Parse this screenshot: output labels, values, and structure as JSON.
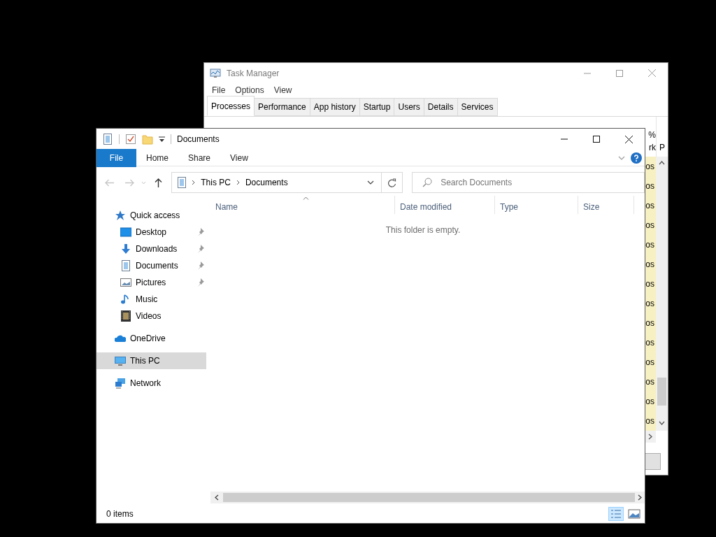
{
  "task_manager": {
    "title": "Task Manager",
    "menu": [
      "File",
      "Options",
      "View"
    ],
    "tabs": [
      {
        "label": "Processes",
        "selected": true
      },
      {
        "label": "Performance",
        "selected": false
      },
      {
        "label": "App history",
        "selected": false
      },
      {
        "label": "Startup",
        "selected": false
      },
      {
        "label": "Users",
        "selected": false
      },
      {
        "label": "Details",
        "selected": false
      },
      {
        "label": "Services",
        "selected": false
      }
    ],
    "column_headers": [
      "%",
      "rk",
      "P"
    ],
    "cells": [
      "os",
      "os",
      "os",
      "os",
      "os",
      "os",
      "os",
      "os",
      "os",
      "os",
      "os",
      "os",
      "os",
      "os"
    ]
  },
  "explorer": {
    "title": "Documents",
    "ribbon_tabs": [
      {
        "label": "File",
        "kind": "file"
      },
      {
        "label": "Home",
        "kind": "tab"
      },
      {
        "label": "Share",
        "kind": "tab"
      },
      {
        "label": "View",
        "kind": "tab"
      }
    ],
    "breadcrumb": [
      "This PC",
      "Documents"
    ],
    "search": {
      "placeholder": "Search Documents"
    },
    "columns": [
      {
        "label": "Name",
        "sorted": true
      },
      {
        "label": "Date modified",
        "sorted": false
      },
      {
        "label": "Type",
        "sorted": false
      },
      {
        "label": "Size",
        "sorted": false
      }
    ],
    "nav": [
      {
        "label": "Quick access",
        "kind": "star",
        "selected": false,
        "children": [
          {
            "label": "Desktop",
            "kind": "desktop",
            "pinned": true
          },
          {
            "label": "Downloads",
            "kind": "download",
            "pinned": true
          },
          {
            "label": "Documents",
            "kind": "document",
            "pinned": true
          },
          {
            "label": "Pictures",
            "kind": "pictures",
            "pinned": true
          },
          {
            "label": "Music",
            "kind": "music",
            "pinned": false
          },
          {
            "label": "Videos",
            "kind": "video",
            "pinned": false
          }
        ]
      },
      {
        "label": "OneDrive",
        "kind": "cloud",
        "selected": false
      },
      {
        "label": "This PC",
        "kind": "pc",
        "selected": true
      },
      {
        "label": "Network",
        "kind": "network",
        "selected": false
      }
    ],
    "empty_message": "This folder is empty.",
    "status": "0 items",
    "view_modes": [
      {
        "kind": "details",
        "selected": true
      },
      {
        "kind": "large-icons",
        "selected": false
      }
    ]
  }
}
